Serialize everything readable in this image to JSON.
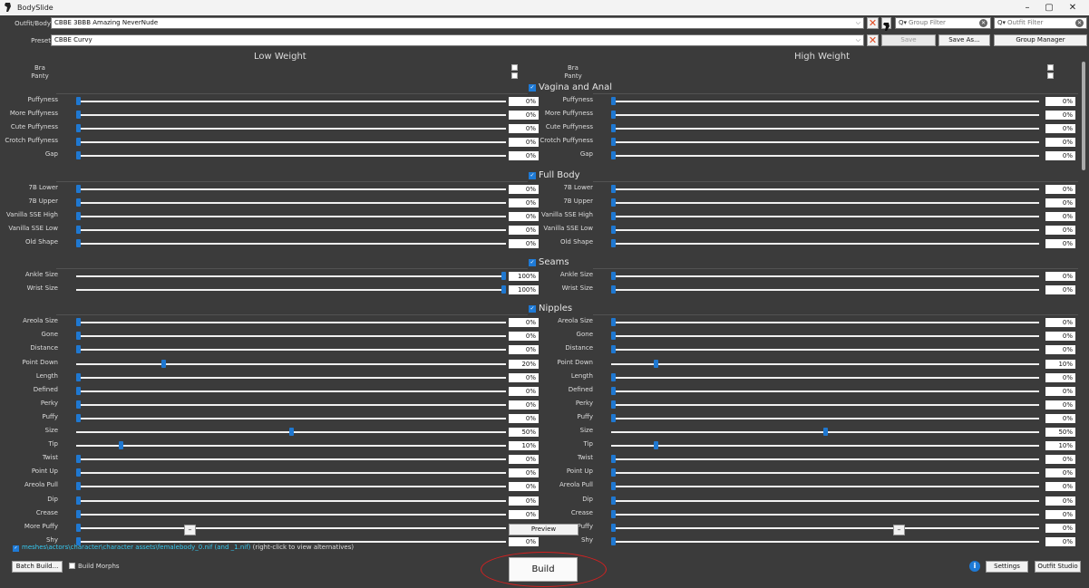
{
  "window": {
    "title": "BodySlide",
    "minimize": "–",
    "maximize": "▢",
    "close": "✕"
  },
  "top": {
    "outfit_label": "Outfit/Body",
    "outfit_value": "CBBE 3BBB Amazing NeverNude",
    "preset_label": "Preset",
    "preset_value": "CBBE Curvy",
    "group_filter_placeholder": "Group Filter",
    "outfit_filter_placeholder": "Outfit Filter",
    "save": "Save",
    "save_as": "Save As...",
    "group_manager": "Group Manager"
  },
  "panels": {
    "low_title": "Low Weight",
    "high_title": "High Weight",
    "bra": "Bra",
    "panty": "Panty"
  },
  "groups": [
    {
      "name": "Vagina and Anal",
      "sliders": [
        {
          "name": "Puffyness",
          "low": 0,
          "high": 0
        },
        {
          "name": "More Puffyness",
          "low": 0,
          "high": 0
        },
        {
          "name": "Cute Puffyness",
          "low": 0,
          "high": 0
        },
        {
          "name": "Crotch Puffyness",
          "low": 0,
          "high": 0
        },
        {
          "name": "Gap",
          "low": 0,
          "high": 0
        }
      ]
    },
    {
      "name": "Full Body",
      "sliders": [
        {
          "name": "7B Lower",
          "low": 0,
          "high": 0
        },
        {
          "name": "7B Upper",
          "low": 0,
          "high": 0
        },
        {
          "name": "Vanilla SSE High",
          "low": 0,
          "high": 0
        },
        {
          "name": "Vanilla SSE Low",
          "low": 0,
          "high": 0
        },
        {
          "name": "Old Shape",
          "low": 0,
          "high": 0
        }
      ]
    },
    {
      "name": "Seams",
      "sliders": [
        {
          "name": "Ankle Size",
          "low": 100,
          "high": 0
        },
        {
          "name": "Wrist Size",
          "low": 100,
          "high": 0
        }
      ]
    },
    {
      "name": "Nipples",
      "sliders": [
        {
          "name": "Areola Size",
          "low": 0,
          "high": 0
        },
        {
          "name": "Gone",
          "low": 0,
          "high": 0
        },
        {
          "name": "Distance",
          "low": 0,
          "high": 0
        },
        {
          "name": "Point Down",
          "low": 20,
          "high": 10
        },
        {
          "name": "Length",
          "low": 0,
          "high": 0
        },
        {
          "name": "Defined",
          "low": 0,
          "high": 0
        },
        {
          "name": "Perky",
          "low": 0,
          "high": 0
        },
        {
          "name": "Puffy",
          "low": 0,
          "high": 0
        },
        {
          "name": "Size",
          "low": 50,
          "high": 50
        },
        {
          "name": "Tip",
          "low": 10,
          "high": 10
        },
        {
          "name": "Twist",
          "low": 0,
          "high": 0
        },
        {
          "name": "Point Up",
          "low": 0,
          "high": 0
        },
        {
          "name": "Areola Pull",
          "low": 0,
          "high": 0
        },
        {
          "name": "Dip",
          "low": 0,
          "high": 0
        },
        {
          "name": "Crease",
          "low": 0,
          "high": 0
        },
        {
          "name": "More Puffy",
          "low": 0,
          "high": 0
        },
        {
          "name": "Shy",
          "low": 0,
          "high": 0
        }
      ]
    }
  ],
  "bottom": {
    "preview": "Preview",
    "minus": "–",
    "output_path": "meshes\\actors\\character\\character assets\\femalebody_0.nif (and _1.nif)",
    "output_hint": "(right-click to view alternatives)",
    "batch_build": "Batch Build...",
    "build_morphs": "Build Morphs",
    "build": "Build",
    "info": "i",
    "settings": "Settings",
    "outfit_studio": "Outfit Studio"
  }
}
